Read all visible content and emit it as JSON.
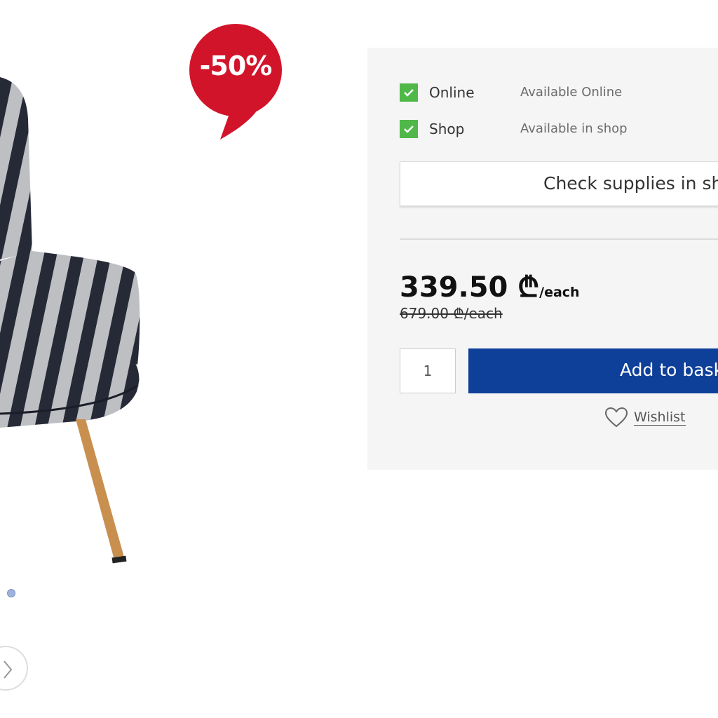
{
  "badge": {
    "discount": "-50%",
    "color": "#d2142a"
  },
  "carousel": {
    "dots": 1
  },
  "availability": [
    {
      "label": "Online",
      "status": "Available Online",
      "checked": true
    },
    {
      "label": "Shop",
      "status": "Available in shop",
      "checked": true
    }
  ],
  "check_supplies": {
    "label": "Check supplies in sho"
  },
  "price": {
    "current": "339.50 ₾",
    "current_unit": "/each",
    "original": "679.00 ₾/each"
  },
  "quantity": {
    "value": "1"
  },
  "add_to_basket": {
    "label": "Add to bask",
    "color": "#0e3f99"
  },
  "wishlist": {
    "label": "Wishlist"
  },
  "icons": {
    "check": "checkmark-icon",
    "heart": "heart-icon",
    "arrow": "chevron-right-icon"
  }
}
